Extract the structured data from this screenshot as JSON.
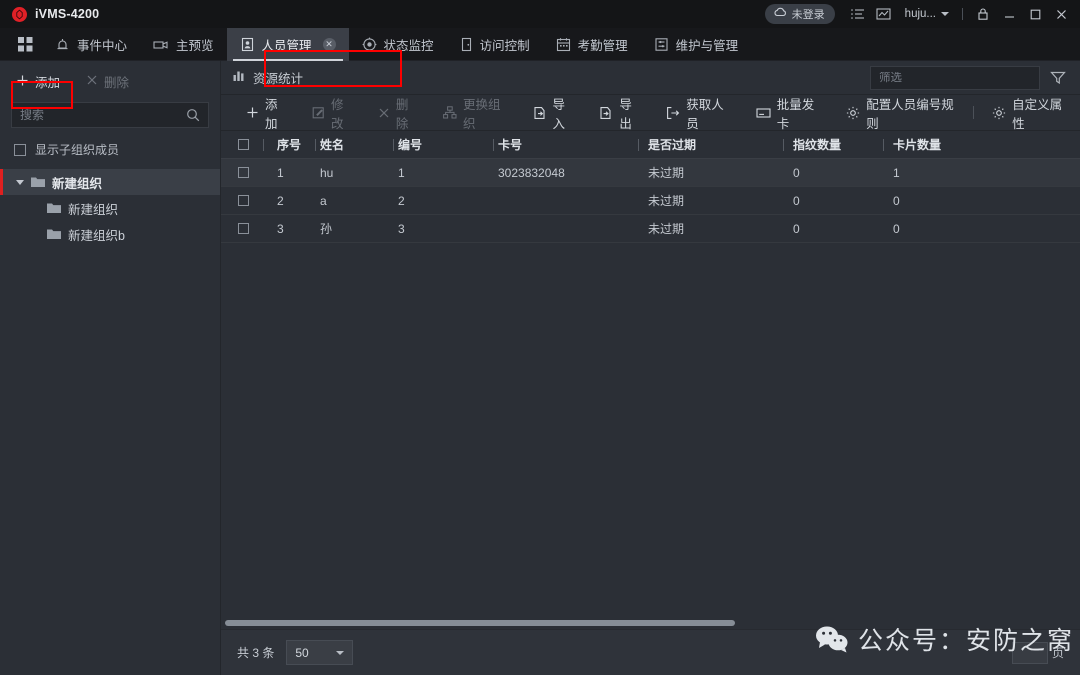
{
  "app": {
    "title": "iVMS-4200",
    "logo_color": "#e12027"
  },
  "titlebar": {
    "cloud_status": "未登录",
    "cloud_icon": "cloud-icon",
    "list_icon": "list-icon",
    "chart_icon": "chart-icon",
    "user_name": "huju...",
    "user_caret_icon": "chevron-down-icon",
    "lock_icon": "lock-icon",
    "minimize_icon": "minimize-icon",
    "maximize_icon": "maximize-icon",
    "close_icon": "close-icon"
  },
  "nav": {
    "grid_icon": "grid-icon",
    "items": [
      {
        "label": "事件中心",
        "icon": "alarm-icon",
        "active": false
      },
      {
        "label": "主预览",
        "icon": "camera-icon",
        "active": false
      },
      {
        "label": "人员管理",
        "icon": "person-card-icon",
        "active": true,
        "closable": true
      },
      {
        "label": "状态监控",
        "icon": "radar-icon",
        "active": false
      },
      {
        "label": "访问控制",
        "icon": "door-icon",
        "active": false
      },
      {
        "label": "考勤管理",
        "icon": "calendar-icon",
        "active": false
      },
      {
        "label": "维护与管理",
        "icon": "settings-list-icon",
        "active": false
      }
    ],
    "highlight_color": "#fe0000"
  },
  "sidebar": {
    "add_label": "添加",
    "add_icon": "plus-icon",
    "delete_label": "删除",
    "delete_icon": "close-x-icon",
    "delete_disabled": true,
    "search_placeholder": "搜索",
    "search_value": "",
    "search_icon": "search-icon",
    "show_sub_label": "显示子组织成员",
    "show_sub_checked": false,
    "tree": [
      {
        "label": "新建组织",
        "level": 0,
        "expanded": true,
        "selected": true,
        "icon": "folder-icon"
      },
      {
        "label": "新建组织",
        "level": 1,
        "expanded": false,
        "selected": false,
        "icon": "folder-icon"
      },
      {
        "label": "新建组织b",
        "level": 1,
        "expanded": false,
        "selected": false,
        "icon": "folder-icon"
      }
    ]
  },
  "resource_bar": {
    "label": "资源统计",
    "icon": "bar-chart-icon",
    "filter_placeholder": "筛选",
    "filter_value": "",
    "funnel_icon": "funnel-icon"
  },
  "toolbar": {
    "items": [
      {
        "label": "添加",
        "icon": "plus-icon",
        "disabled": false
      },
      {
        "label": "修改",
        "icon": "pencil-icon",
        "disabled": true
      },
      {
        "label": "删除",
        "icon": "close-x-icon",
        "disabled": true
      },
      {
        "label": "更换组织",
        "icon": "org-tree-icon",
        "disabled": true
      },
      {
        "label": "导入",
        "icon": "import-icon",
        "disabled": false
      },
      {
        "label": "导出",
        "icon": "export-icon",
        "disabled": false
      },
      {
        "label": "获取人员",
        "icon": "fetch-person-icon",
        "disabled": false
      },
      {
        "label": "批量发卡",
        "icon": "card-icon",
        "disabled": false
      },
      {
        "label": "配置人员编号规则",
        "icon": "gear-icon",
        "disabled": false
      },
      {
        "label": "自定义属性",
        "icon": "gear-icon",
        "disabled": false
      }
    ]
  },
  "table": {
    "select_all_checked": false,
    "columns": [
      "序号",
      "姓名",
      "编号",
      "卡号",
      "是否过期",
      "指纹数量",
      "卡片数量"
    ],
    "rows": [
      {
        "checked": false,
        "seq": "1",
        "name": "hu",
        "number": "1",
        "card": "3023832048",
        "expired": "未过期",
        "fingerprints": "0",
        "cards": "1"
      },
      {
        "checked": false,
        "seq": "2",
        "name": "a",
        "number": "2",
        "card": "",
        "expired": "未过期",
        "fingerprints": "0",
        "cards": "0"
      },
      {
        "checked": false,
        "seq": "3",
        "name": "孙",
        "number": "3",
        "card": "",
        "expired": "未过期",
        "fingerprints": "0",
        "cards": "0"
      }
    ]
  },
  "statusbar": {
    "total_label": "共 3 条",
    "page_size": "50",
    "page_size_caret": "chevron-down-icon",
    "page_suffix": "页"
  },
  "watermark": {
    "text": "公众号：安防之窝",
    "icon": "wechat-icon"
  }
}
